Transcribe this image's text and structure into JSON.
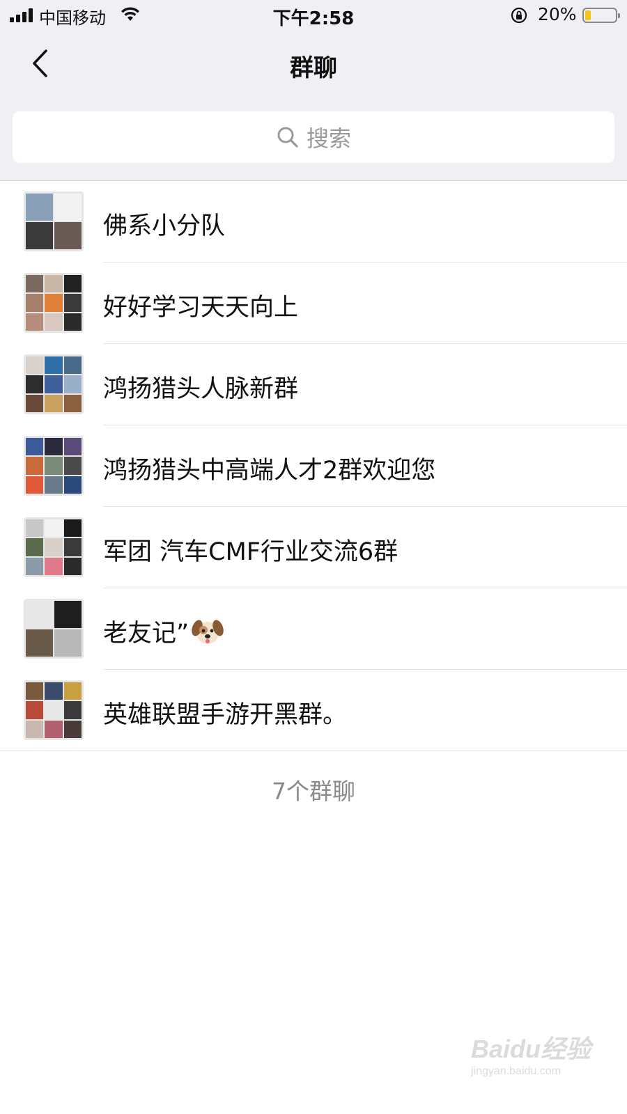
{
  "status_bar": {
    "carrier": "中国移动",
    "time": "下午2:58",
    "battery_percent": "20%",
    "battery_level": 0.2,
    "battery_color": "#f5c518"
  },
  "nav": {
    "back_icon": "chevron-left-icon",
    "title": "群聊"
  },
  "search": {
    "icon": "search-icon",
    "placeholder": "搜索"
  },
  "groups": [
    {
      "name": "佛系小分队",
      "avatar_cells": 4,
      "avatar_colors": [
        "#8aa0b8",
        "#f2f2f2",
        "#3a3a3a",
        "#6a5a55"
      ]
    },
    {
      "name": "好好学习天天向上",
      "avatar_cells": 9,
      "avatar_colors": [
        "#7a6a60",
        "#c9b7a8",
        "#222222",
        "#a6806a",
        "#e0813a",
        "#3b3b3b",
        "#b58d7a",
        "#d8c8c0",
        "#2a2a2a"
      ]
    },
    {
      "name": "鸿扬猎头人脉新群",
      "avatar_cells": 9,
      "avatar_colors": [
        "#d9d2cc",
        "#2f6fa8",
        "#4a6a8a",
        "#2d2d2d",
        "#3e5f9a",
        "#9ab0c8",
        "#6a4a3a",
        "#c8a060",
        "#8a6040"
      ]
    },
    {
      "name": "鸿扬猎头中高端人才2群欢迎您",
      "avatar_cells": 9,
      "avatar_colors": [
        "#3a5a9a",
        "#2a2a3a",
        "#5a4a7a",
        "#c86a3a",
        "#7a8a7a",
        "#4a4a4a",
        "#e05a3a",
        "#6a7a8a",
        "#2a4a7a"
      ]
    },
    {
      "name": "军团 汽车CMF行业交流6群",
      "avatar_cells": 9,
      "avatar_colors": [
        "#c8c8c8",
        "#f2f2f2",
        "#1a1a1a",
        "#5a6a4a",
        "#d8d0c8",
        "#3a3a3a",
        "#8a9aa8",
        "#e07a8a",
        "#2a2a2a"
      ]
    },
    {
      "name": "老友记”",
      "emoji": "dog-face-emoji",
      "avatar_cells": 4,
      "avatar_colors": [
        "#e8e8e8",
        "#1e1e1e",
        "#6a5a4a",
        "#b8b8b8"
      ]
    },
    {
      "name": "英雄联盟手游开黑群。",
      "avatar_cells": 9,
      "avatar_colors": [
        "#7a5a3a",
        "#3a4a6a",
        "#c8a040",
        "#b84a3a",
        "#e8e8e8",
        "#3a3a3a",
        "#c8b8b0",
        "#b06070",
        "#4a3a3a"
      ]
    }
  ],
  "footer_count": "7个群聊",
  "watermark": {
    "main": "Baidu经验",
    "sub": "jingyan.baidu.com"
  }
}
